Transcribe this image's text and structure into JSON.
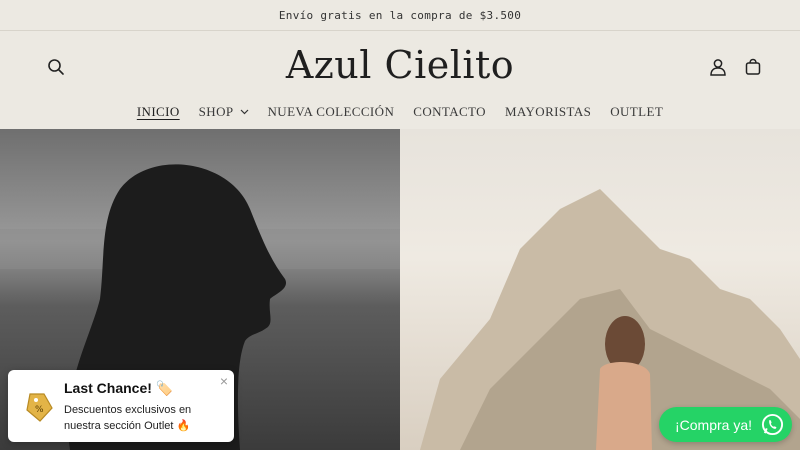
{
  "announcement": {
    "text": "Envío gratis en la compra de $3.500"
  },
  "header": {
    "logo": "Azul Cielito"
  },
  "nav": {
    "items": [
      {
        "label": "INICIO"
      },
      {
        "label": "SHOP"
      },
      {
        "label": "NUEVA COLECCIÓN"
      },
      {
        "label": "CONTACTO"
      },
      {
        "label": "MAYORISTAS"
      },
      {
        "label": "OUTLET"
      }
    ]
  },
  "popup": {
    "title": "Last Chance! 🏷️",
    "text": "Descuentos exclusivos en nuestra sección Outlet 🔥",
    "close": "×"
  },
  "whatsapp": {
    "label": "¡Compra ya!"
  },
  "colors": {
    "background": "#ece9e2",
    "whatsapp": "#25d366"
  },
  "icons": {
    "search": "search-icon",
    "account": "account-icon",
    "cart": "cart-icon",
    "chevron": "chevron-down-icon",
    "whatsapp": "whatsapp-icon",
    "tag": "tag-icon"
  }
}
